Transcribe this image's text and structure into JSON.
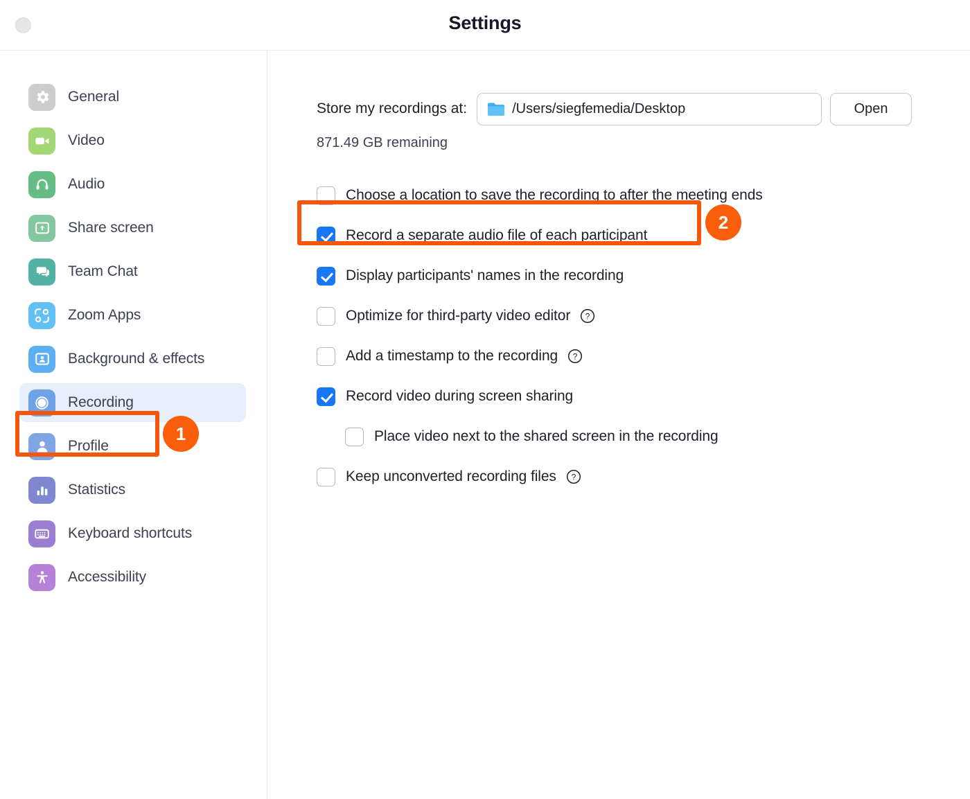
{
  "window": {
    "title": "Settings",
    "close_button": "close-window-button"
  },
  "sidebar": {
    "items": [
      {
        "label": "General",
        "icon": "gear-icon",
        "color": "#cdcdcd",
        "selected": false
      },
      {
        "label": "Video",
        "icon": "video-camera-icon",
        "color": "#a3d675",
        "selected": false
      },
      {
        "label": "Audio",
        "icon": "headphones-icon",
        "color": "#66bd84",
        "selected": false
      },
      {
        "label": "Share screen",
        "icon": "share-screen-icon",
        "color": "#82c79f",
        "selected": false
      },
      {
        "label": "Team Chat",
        "icon": "chat-bubbles-icon",
        "color": "#52b2a3",
        "selected": false
      },
      {
        "label": "Zoom Apps",
        "icon": "zoom-apps-icon",
        "color": "#62c0f5",
        "selected": false
      },
      {
        "label": "Background & effects",
        "icon": "person-frame-icon",
        "color": "#5cb0f2",
        "selected": false
      },
      {
        "label": "Recording",
        "icon": "record-circle-icon",
        "color": "#6fa3e8",
        "selected": true
      },
      {
        "label": "Profile",
        "icon": "person-icon",
        "color": "#7fa6e3",
        "selected": false
      },
      {
        "label": "Statistics",
        "icon": "bar-chart-icon",
        "color": "#7f87cf",
        "selected": false
      },
      {
        "label": "Keyboard shortcuts",
        "icon": "keyboard-icon",
        "color": "#9b7ed2",
        "selected": false
      },
      {
        "label": "Accessibility",
        "icon": "accessibility-icon",
        "color": "#b682d8",
        "selected": false
      }
    ]
  },
  "main": {
    "store_label": "Store my recordings at:",
    "path_value": "/Users/siegfemedia/Desktop",
    "path_icon": "folder-icon",
    "open_button": "Open",
    "remaining": "871.49 GB remaining",
    "options": [
      {
        "label": "Choose a location to save the recording to after the meeting ends",
        "checked": false,
        "help": false,
        "indent": false
      },
      {
        "label": "Record a separate audio file of each participant",
        "checked": true,
        "help": false,
        "indent": false
      },
      {
        "label": "Display participants' names in the recording",
        "checked": true,
        "help": false,
        "indent": false
      },
      {
        "label": "Optimize for third-party video editor",
        "checked": false,
        "help": true,
        "indent": false
      },
      {
        "label": "Add a timestamp to the recording",
        "checked": false,
        "help": true,
        "indent": false
      },
      {
        "label": "Record video during screen sharing",
        "checked": true,
        "help": false,
        "indent": false
      },
      {
        "label": "Place video next to the shared screen in the recording",
        "checked": false,
        "help": false,
        "indent": true
      },
      {
        "label": "Keep unconverted recording files",
        "checked": false,
        "help": true,
        "indent": false
      }
    ]
  },
  "annotations": {
    "color": "#f4560c",
    "badge_color": "#fa5e0a",
    "badges": [
      {
        "number": "1",
        "target": "sidebar-item-recording"
      },
      {
        "number": "2",
        "target": "option-record-separate-audio"
      }
    ]
  }
}
